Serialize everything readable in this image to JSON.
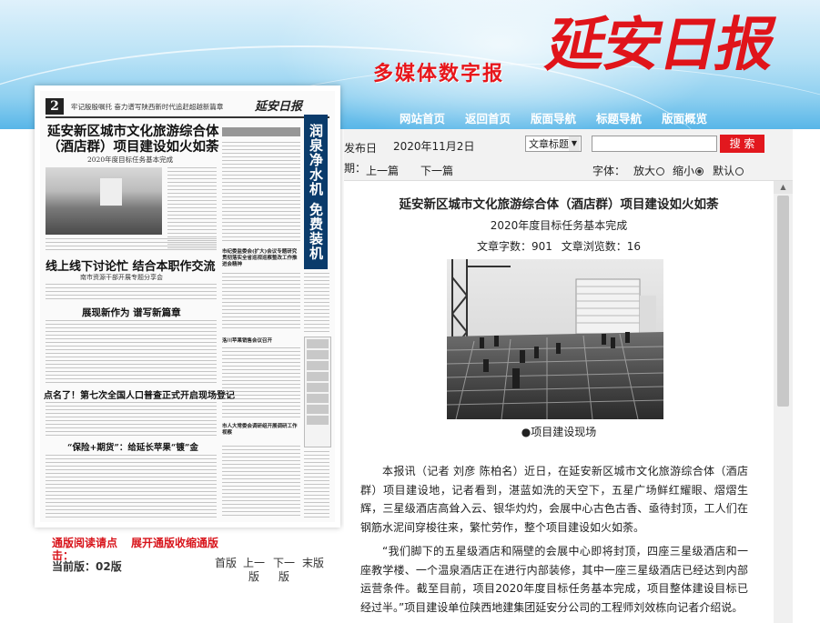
{
  "header": {
    "subtitle": "多媒体数字报",
    "logo": "延安日报",
    "nav": [
      "网站首页",
      "返回首页",
      "版面导航",
      "标题导航",
      "版面概览"
    ]
  },
  "thumbnail": {
    "page_num": "2",
    "top_line": "牢记殷殷嘱托  奋力谱写陕西新时代追赶超越新篇章",
    "top_tag": "要闻",
    "masthead": "延安日报",
    "headline1": "延安新区城市文化旅游综合体（酒店群）项目建设如火如荼",
    "headline1_sub": "2020年度目标任务基本完成",
    "headline2": "线上线下讨论忙  结合本职作交流",
    "headline2_sub": "南市资源干部开展专题分享会",
    "headline3": "展现新作为  谱写新篇章",
    "headline4": "点名了！第七次全国人口普查正式开启现场登记",
    "headline5": "“保险+期货”：给延长苹果“镀”金",
    "vertical_ad": "润泉净水机  免费装机",
    "mid_text1": "市纪委监委会(扩大)会议专题研究贯彻落实全省巡视巡察整改工作推进会精神",
    "mid_text2": "洛川苹果销售会议召开",
    "mid_text3": "市人大常委会调研组开展调研工作视察"
  },
  "left_links": {
    "tip1": "通版阅读请点击：",
    "tip2": "展开通版收缩通版",
    "current_page": "当前版：02版",
    "pager": [
      "首版",
      "上一版",
      "下一版",
      "末版"
    ]
  },
  "controls": {
    "pub_label": "发布日期：",
    "pub_date": "2020年11月2日",
    "search_type": "文章标题",
    "search_placeholder": "",
    "search_btn": "搜 索",
    "prev": "上一篇",
    "next": "下一篇",
    "font_label": "字体：",
    "font_big": "放大",
    "font_small": "缩小",
    "font_default": "默认"
  },
  "article": {
    "title": "延安新区城市文化旅游综合体（酒店群）项目建设如火如荼",
    "subtitle": "2020年度目标任务基本完成",
    "stats": "文章字数：901   文章浏览数：16",
    "caption": "●项目建设现场",
    "paragraphs": [
      "本报讯（记者 刘彦 陈柏名）近日，在延安新区城市文化旅游综合体（酒店群）项目建设地，记者看到，湛蓝如洗的天空下，五星广场鲜红耀眼、熠熠生辉，三星级酒店高耸入云、银华灼灼，会展中心古色古香、亟待封顶，工人们在钢筋水泥间穿梭往来，繁忙劳作，整个项目建设如火如荼。",
      "“我们脚下的五星级酒店和隔壁的会展中心即将封顶，四座三星级酒店和一座教学楼、一个温泉酒店正在进行内部装修，其中一座三星级酒店已经达到内部运营条件。截至目前，项目2020年度目标任务基本完成，项目整体建设目标已经过半。”项目建设单位陕西地建集团延安分公司的工程师刘效栋向记者介绍说。"
    ]
  }
}
